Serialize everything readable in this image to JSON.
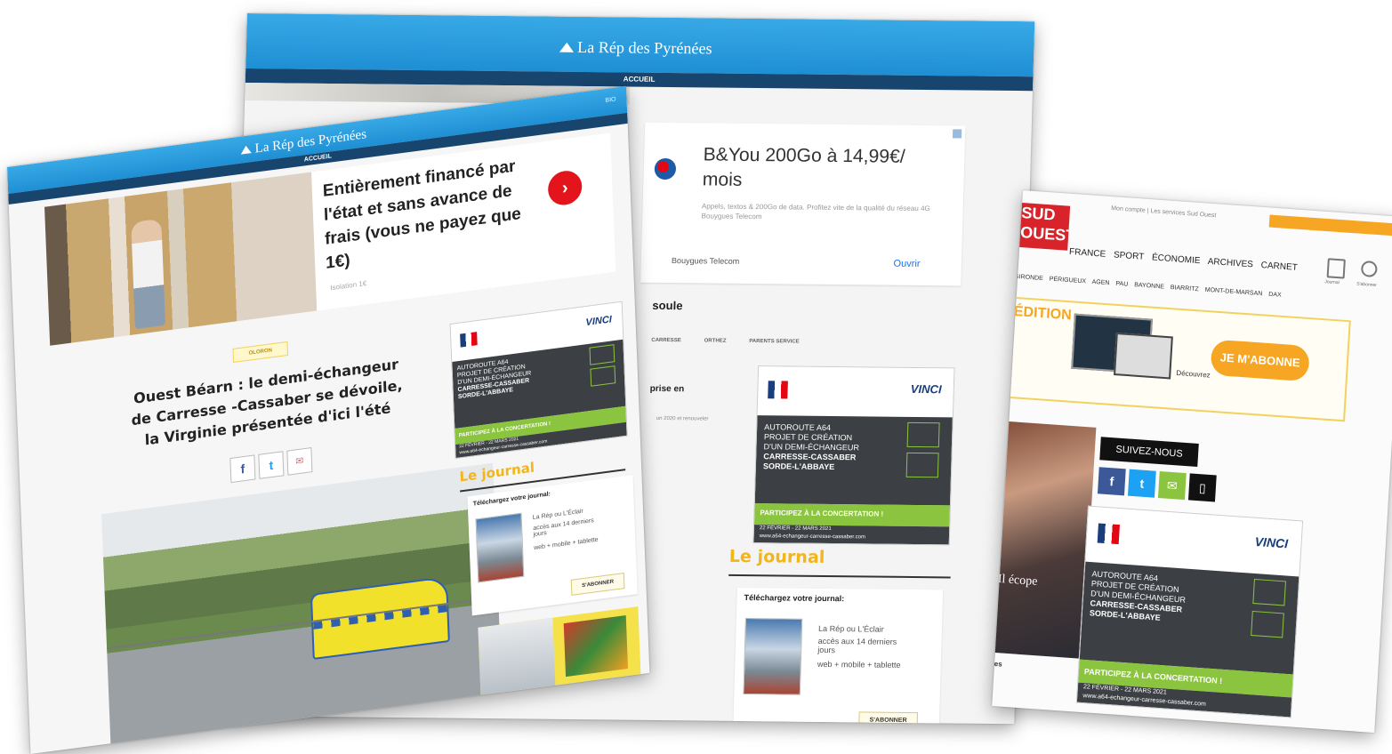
{
  "colors": {
    "brand_blue": "#2b9de0",
    "nav_navy": "#17456e",
    "accent_yellow": "#f2b51a",
    "vinci_dark": "#3c3f43",
    "vinci_green": "#8bc53f",
    "red_arrow": "#e3141b",
    "sud_ouest_orange": "#f6a623"
  },
  "back_page": {
    "logo": "La Rép des Pyrénées",
    "nav_item": "ACCUEIL",
    "ad": {
      "title": "B&You 200Go à 14,99€/ mois",
      "body": "Appels, textos & 200Go de data. Profitez vite de la qualité du réseau 4G Bouygues Telecom",
      "advertiser": "Bouygues Telecom",
      "cta": "Ouvrir"
    },
    "section_title": "soule",
    "tabs": [
      "CARRESSE",
      "ORTHEZ",
      "PARENTS SERVICE"
    ],
    "snippet_heading": "prise en",
    "snippet_text": "un 2020 et renouveler",
    "vinci_banner": {
      "line1": "AUTOROUTE A64",
      "line2": "PROJET DE CRÉATION",
      "line3": "D'UN DEMI-ÉCHANGEUR",
      "line4": "CARRESSE-CASSABER",
      "line5": "SORDE-L'ABBAYE",
      "cta": "PARTICIPEZ À LA CONCERTATION !",
      "dates": "22 FÉVRIER - 22 MARS 2021",
      "url": "www.a64-echangeur-carresse-cassaber.com",
      "brand": "VINCI"
    },
    "journal_title": "Le journal",
    "journal_card": {
      "heading": "Téléchargez votre journal:",
      "text1": "La Rép ou L'Éclair",
      "text2": "accès aux 14 derniers jours",
      "text3": "web + mobile + tablette",
      "button": "S'ABONNER"
    }
  },
  "right_page": {
    "logo_text": "SUD OUEST",
    "top_links": "Mon compte | Les services Sud Ouest",
    "nav": [
      "FRANCE",
      "SPORT",
      "ÉCONOMIE",
      "ARCHIVES",
      "CARNET"
    ],
    "subnav": [
      "GIRONDE",
      "PÉRIGUEUX",
      "AGEN",
      "PAU",
      "BAYONNE",
      "BIARRITZ",
      "MONT-DE-MARSAN",
      "DAX"
    ],
    "icon_labels": [
      "Journal",
      "S'abonner"
    ],
    "promo_title": "ÉDITION",
    "promo_device_text": "Découvrez",
    "subscribe_button": "JE M'ABONNE",
    "follow_title": "SUIVEZ-NOUS",
    "photo_caption": "Il écope",
    "bottom_text": "eries",
    "vinci_banner": {
      "line1": "AUTOROUTE A64",
      "line2": "PROJET DE CRÉATION",
      "line3": "D'UN DEMI-ÉCHANGEUR",
      "line4": "CARRESSE-CASSABER",
      "line5": "SORDE-L'ABBAYE",
      "cta": "PARTICIPEZ À LA CONCERTATION !",
      "dates": "22 FÉVRIER - 22 MARS 2021",
      "url": "www.a64-echangeur-carresse-cassaber.com",
      "brand": "VINCI"
    }
  },
  "front_page": {
    "logo": "La Rép des Pyrénées",
    "nav_item": "ACCUEIL",
    "top_right": "BIO",
    "ad_headline": "Entièrement financé par l'état et sans avance de frais (vous ne payez que 1€)",
    "ad_source": "Isolation 1€",
    "tag": "OLORON",
    "article_title": "Ouest Béarn : le demi-échangeur de Carresse -Cassaber se dévoile, la Virginie présentée d'ici l'été",
    "vinci_banner": {
      "line1": "AUTOROUTE A64",
      "line2": "PROJET DE CRÉATION",
      "line3": "D'UN DEMI-ÉCHANGEUR",
      "line4": "CARRESSE-CASSABER",
      "line5": "SORDE-L'ABBAYE",
      "cta": "PARTICIPEZ À LA CONCERTATION !",
      "dates": "22 FÉVRIER - 22 MARS 2021",
      "url": "www.a64-echangeur-carresse-cassaber.com",
      "brand": "VINCI"
    },
    "journal_title": "Le journal",
    "journal_card": {
      "heading": "Téléchargez votre journal:",
      "text1": "La Rép ou L'Éclair",
      "text2": "accès aux 14 derniers jours",
      "text3": "web + mobile + tablette",
      "button": "S'ABONNER"
    }
  }
}
